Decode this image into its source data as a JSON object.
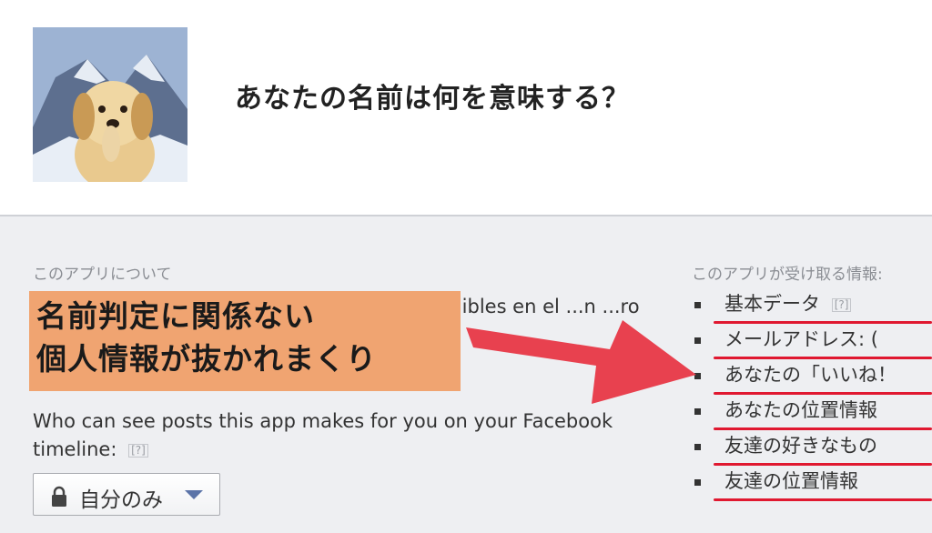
{
  "header": {
    "title": "あなたの名前は何を意味する？"
  },
  "about": {
    "heading": "このアプリについて",
    "description": "¡Más... ...oticias! ...ndeys ahora están disponibles en el ...n ...ro para representar a tu estado de ánimo"
  },
  "overlay": {
    "line1": "名前判定に関係ない",
    "line2": "個人情報が抜かれまくり"
  },
  "visibility": {
    "question": "Who can see posts this app makes for you on your Facebook timeline:",
    "help": "[?]",
    "selected": "自分のみ"
  },
  "permissions": {
    "heading": "このアプリが受け取る情報:",
    "items": [
      {
        "label": "基本データ",
        "help": "[?]"
      },
      {
        "label": "メールアドレス: (",
        "help": ""
      },
      {
        "label": "あなたの「いいね！",
        "help": ""
      },
      {
        "label": "あなたの位置情報",
        "help": ""
      },
      {
        "label": "友達の好きなもの",
        "help": ""
      },
      {
        "label": "友達の位置情報",
        "help": ""
      }
    ]
  },
  "colors": {
    "overlay_bg": "#f0a471",
    "arrow": "#e8414f",
    "underline": "#e01830",
    "panel_bg": "#eeeff2"
  }
}
